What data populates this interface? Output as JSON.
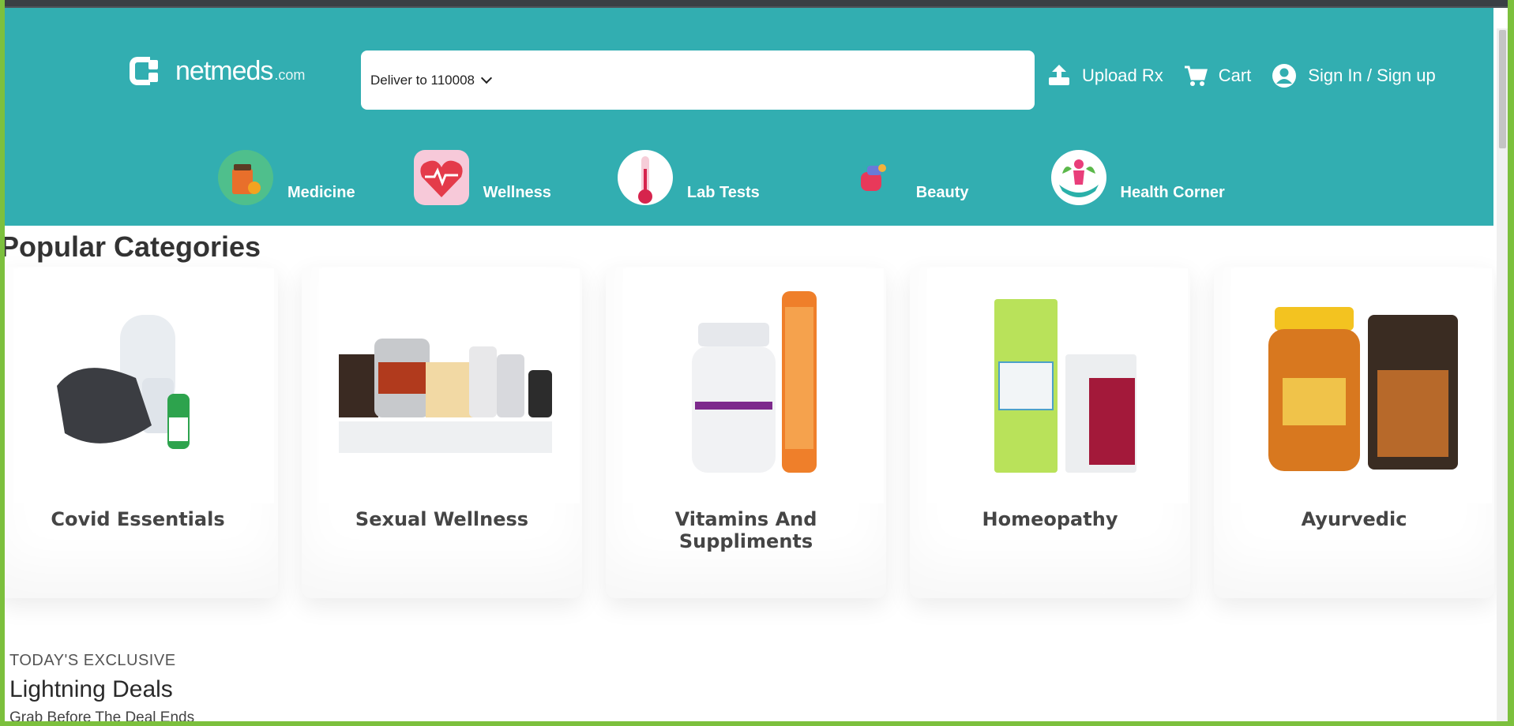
{
  "header": {
    "logo_text": "netmeds",
    "logo_suffix": ".com",
    "deliver_label": "Deliver to 110008",
    "actions": [
      {
        "label": "Upload Rx",
        "icon": "upload-icon"
      },
      {
        "label": "Cart",
        "icon": "cart-icon"
      },
      {
        "label": "Sign In / Sign up",
        "icon": "user-icon"
      }
    ]
  },
  "nav": {
    "categories": [
      {
        "label": "Medicine",
        "icon": "medicine-icon"
      },
      {
        "label": "Wellness",
        "icon": "wellness-heart-icon"
      },
      {
        "label": "Lab Tests",
        "icon": "thermometer-icon"
      },
      {
        "label": "Beauty",
        "icon": "beauty-icon"
      },
      {
        "label": "Health Corner",
        "icon": "health-corner-icon"
      }
    ]
  },
  "popular": {
    "title": "Popular Categories",
    "cards": [
      {
        "label": "Covid Essentials"
      },
      {
        "label": "Sexual Wellness"
      },
      {
        "label": "Vitamins And Suppliments"
      },
      {
        "label": "Homeopathy"
      },
      {
        "label": "Ayurvedic"
      }
    ]
  },
  "deals": {
    "subtitle": "TODAY'S EXCLUSIVE",
    "title": "Lightning Deals",
    "tagline": "Grab Before The Deal Ends"
  },
  "colors": {
    "header_bg": "#32aeb1",
    "frame": "#7cc03d"
  }
}
